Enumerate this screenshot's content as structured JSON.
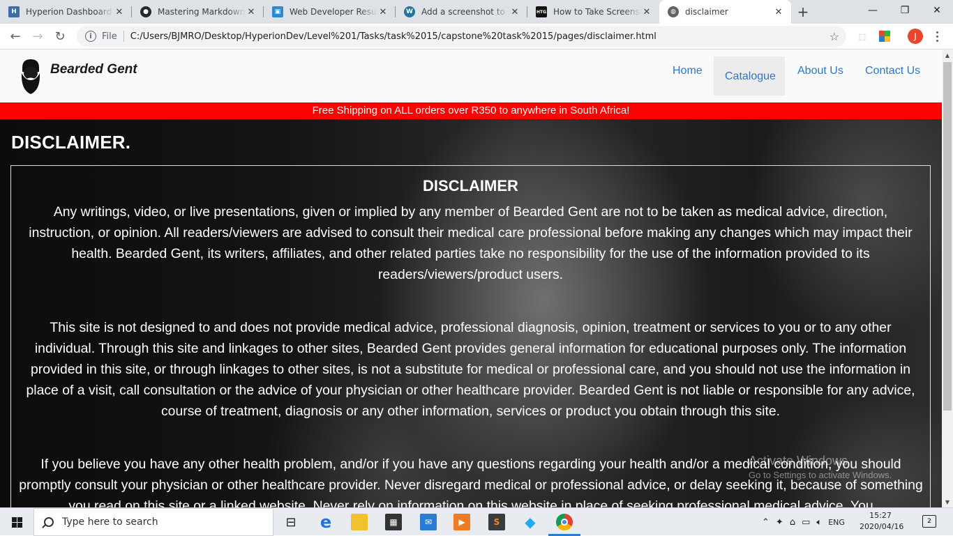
{
  "browser": {
    "tabs": [
      {
        "label": "Hyperion Dashboard",
        "favicon": "hyperion-icon",
        "color": "#3d6ea8",
        "glyph": "H"
      },
      {
        "label": "Mastering Markdown · G",
        "favicon": "github-icon",
        "color": "#24292e",
        "glyph": "●"
      },
      {
        "label": "Web Developer Resume",
        "favicon": "docs-icon",
        "color": "#2b8ad6",
        "glyph": "▣"
      },
      {
        "label": "Add a screenshot to yo",
        "favicon": "wordpress-icon",
        "color": "#21759b",
        "glyph": "W"
      },
      {
        "label": "How to Take Screenshot",
        "favicon": "htg-icon",
        "color": "#111111",
        "glyph": "HTG"
      },
      {
        "label": "disclaimer",
        "favicon": "globe-icon",
        "color": "#5f6368",
        "glyph": "◍"
      }
    ],
    "active_tab": 5,
    "new_tab": "+",
    "window_controls": {
      "minimize": "—",
      "maximize": "❐",
      "close": "✕"
    },
    "nav": {
      "back": "←",
      "forward": "→",
      "reload": "↻"
    },
    "omnibox": {
      "info_glyph": "i",
      "scheme_label": "File",
      "url": "C:/Users/BJMRO/Desktop/HyperionDev/Level%201/Tasks/task%2015/capstone%20task%2015/pages/disclaimer.html",
      "star": "☆"
    },
    "profile_initial": "J"
  },
  "site": {
    "brand": "Bearded Gent",
    "nav": [
      "Home",
      "Catalogue",
      "About Us",
      "Contact Us"
    ],
    "active_nav": "Catalogue",
    "nav_color": "#2b77c7",
    "promo": "Free Shipping on ALL orders over R350 to anywhere in South Africa!",
    "promo_color": "#ff0000",
    "page_heading": "DISCLAIMER.",
    "disclaimer_title": "DISCLAIMER",
    "paragraphs": [
      "Any writings, video, or live presentations, given or implied by any member of Bearded Gent are not to be taken as medical advice, direction, instruction, or opinion. All readers/viewers are advised to consult their medical care professional before making any changes which may impact their health. Bearded Gent, its writers, affiliates, and other related parties take no responsibility for the use of the information provided to its readers/viewers/product users.",
      "This site is not designed to and does not provide medical advice, professional diagnosis, opinion, treatment or services to you or to any other individual. Through this site and linkages to other sites, Bearded Gent provides general information for educational purposes only. The information provided in this site, or through linkages to other sites, is not a substitute for medical or professional care, and you should not use the information in place of a visit, call consultation or the advice of your physician or other healthcare provider. Bearded Gent is not liable or responsible for any advice, course of treatment, diagnosis or any other information, services or product you obtain through this site.",
      "If you believe you have any other health problem, and/or if you have any questions regarding your health and/or a medical condition, you should promptly consult your physician or other healthcare provider. Never disregard medical or professional advice, or delay seeking it, because of something you read on this site or a linked website. Never rely on information on this website in place of seeking professional medical advice. You"
    ]
  },
  "os": {
    "activation_watermark": {
      "title": "Activate Windows",
      "subtitle": "Go to Settings to activate Windows."
    },
    "taskbar": {
      "search_placeholder": "Type here to search",
      "language": "ENG",
      "time": "15:27",
      "date": "2020/04/16",
      "notification_count": "2",
      "apps": [
        {
          "name": "task-view-icon",
          "glyph": "⊟",
          "color": "#e8ecf0"
        },
        {
          "name": "edge-icon",
          "glyph": "e",
          "color": "#1f74d6"
        },
        {
          "name": "file-explorer-icon",
          "glyph": "▬",
          "color": "#f2c12e"
        },
        {
          "name": "store-icon",
          "glyph": "▦",
          "color": "#333333"
        },
        {
          "name": "mail-icon",
          "glyph": "✉",
          "color": "#2a7bd4"
        },
        {
          "name": "media-player-icon",
          "glyph": "▶",
          "color": "#f07b22"
        },
        {
          "name": "sublime-text-icon",
          "glyph": "S",
          "color": "#3b3b3b"
        },
        {
          "name": "vscode-icon",
          "glyph": "◆",
          "color": "#23a9f2"
        },
        {
          "name": "chrome-icon",
          "glyph": "●",
          "color": "#db4437"
        }
      ]
    }
  }
}
